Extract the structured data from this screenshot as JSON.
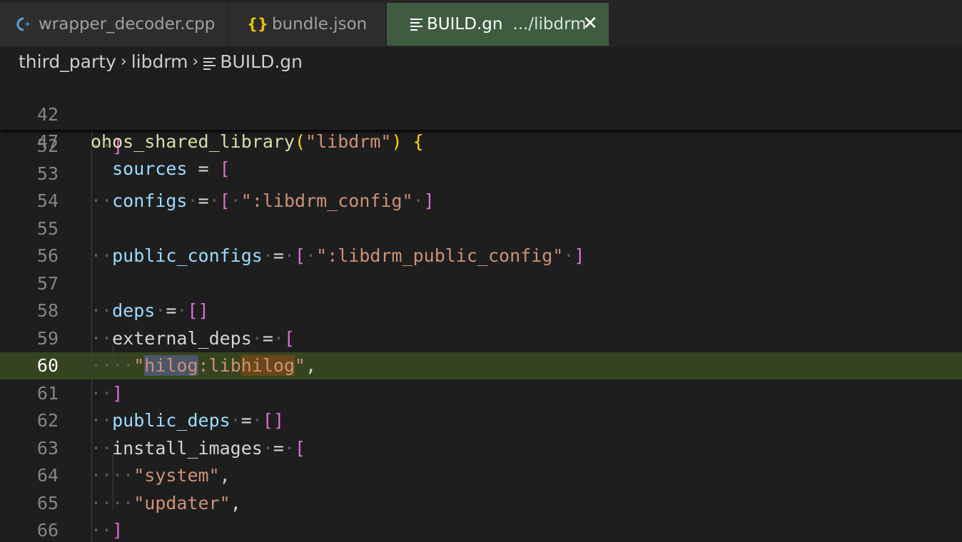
{
  "tabs": [
    {
      "icon": "cpp-file-icon",
      "label": "wrapper_decoder.cpp",
      "active": false
    },
    {
      "icon": "json-file-icon",
      "label": "bundle.json",
      "active": false
    },
    {
      "icon": "text-lines-icon",
      "label": "BUILD.gn",
      "description": ".../libdrm",
      "active": true
    }
  ],
  "breadcrumb": [
    "third_party",
    "libdrm",
    "BUILD.gn"
  ],
  "sticky_lines": [
    {
      "num": "42",
      "text": "ohos_shared_library(\"libdrm\") {"
    },
    {
      "num": "47",
      "text": "  sources = ["
    }
  ],
  "lines": [
    {
      "num": "52",
      "text": "  ]"
    },
    {
      "num": "53",
      "text": ""
    },
    {
      "num": "54",
      "text": "  configs = [ \":libdrm_config\" ]"
    },
    {
      "num": "55",
      "text": ""
    },
    {
      "num": "56",
      "text": "  public_configs = [ \":libdrm_public_config\" ]"
    },
    {
      "num": "57",
      "text": ""
    },
    {
      "num": "58",
      "text": "  deps = []"
    },
    {
      "num": "59",
      "text": "  external_deps = ["
    },
    {
      "num": "60",
      "text": "    \"hilog:libhilog\","
    },
    {
      "num": "61",
      "text": "  ]"
    },
    {
      "num": "62",
      "text": "  public_deps = []"
    },
    {
      "num": "63",
      "text": "  install_images = ["
    },
    {
      "num": "64",
      "text": "    \"system\","
    },
    {
      "num": "65",
      "text": "    \"updater\","
    },
    {
      "num": "66",
      "text": "  ]"
    }
  ],
  "current_line": "60",
  "colors": {
    "active_tab": "#3f5c41",
    "current_line_bg": "#35441f",
    "keyword_blue": "#9cdcfe",
    "string_orange": "#ce9178",
    "bracket_yellow": "#ffd700",
    "bracket_purple": "#da70d6"
  }
}
